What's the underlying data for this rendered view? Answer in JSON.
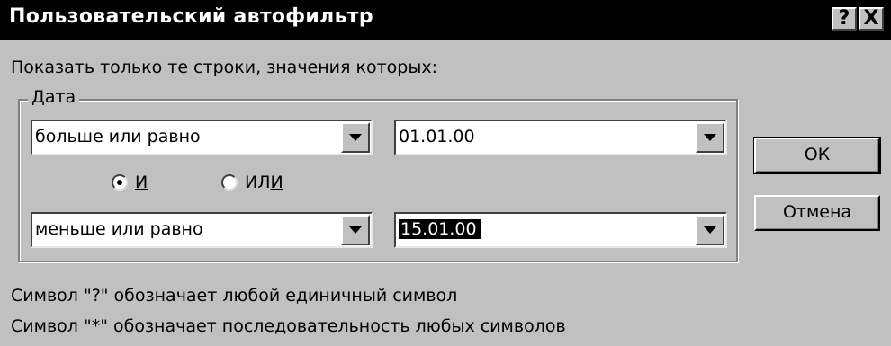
{
  "dialog": {
    "title": "Пользовательский автофильтр",
    "help_button": "?",
    "close_button": "X",
    "intro_text": "Показать только те строки, значения которых:"
  },
  "group": {
    "legend": "Дата",
    "condition1": {
      "operator": "больше или равно",
      "value": "01.01.00"
    },
    "condition2": {
      "operator": "меньше или равно",
      "value": "15.01.00"
    },
    "logic": {
      "and": {
        "underlined": "И",
        "rest": "",
        "checked": true
      },
      "or": {
        "prefix": "ИЛ",
        "underlined": "И",
        "checked": false
      }
    }
  },
  "buttons": {
    "ok": "ОК",
    "cancel": "Отмена"
  },
  "hints": [
    "Символ \"?\" обозначает любой единичный символ",
    "Символ \"*\" обозначает последовательность любых символов"
  ]
}
